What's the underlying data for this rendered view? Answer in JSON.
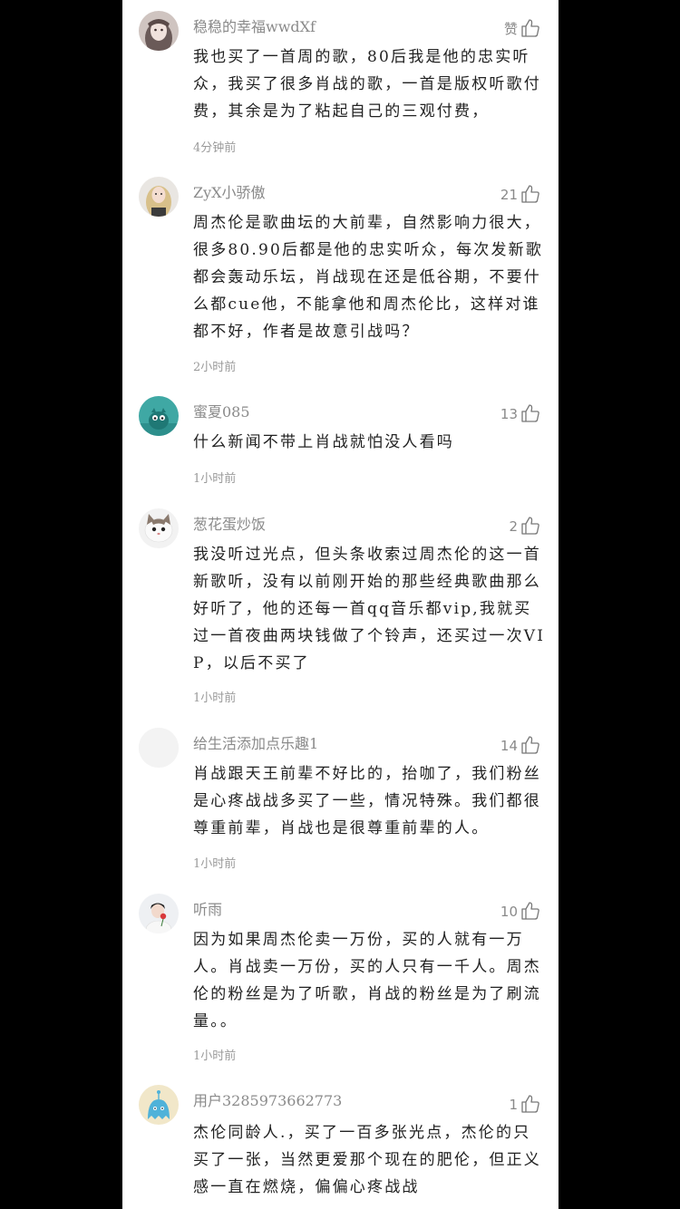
{
  "comments": [
    {
      "username": "稳稳的幸福wwdXf",
      "like_count": "赞",
      "content": "我也买了一首周的歌，80后我是他的忠实听众，我买了很多肖战的歌，一首是版权听歌付费，其余是为了粘起自己的三观付费，",
      "time": "4分钟前",
      "avatar_icon": "girl-portrait-avatar"
    },
    {
      "username": "ZyX小骄傲",
      "like_count": "21",
      "content": "周杰伦是歌曲坛的大前辈，自然影响力很大，很多80.90后都是他的忠实听众，每次发新歌都会轰动乐坛，肖战现在还是低谷期，不要什么都cue他，不能拿他和周杰伦比，这样对谁都不好，作者是故意引战吗？",
      "time": "2小时前",
      "avatar_icon": "blonde-woman-avatar"
    },
    {
      "username": "蜜夏085",
      "like_count": "13",
      "content": "什么新闻不带上肖战就怕没人看吗",
      "time": "1小时前",
      "avatar_icon": "teal-monster-avatar"
    },
    {
      "username": "葱花蛋炒饭",
      "like_count": "2",
      "content": "我没听过光点，但头条收索过周杰伦的这一首新歌听，没有以前刚开始的那些经典歌曲那么好听了，他的还每一首qq音乐都vip,我就买过一首夜曲两块钱做了个铃声，还买过一次VIP，以后不买了",
      "time": "1小时前",
      "avatar_icon": "cat-avatar"
    },
    {
      "username": "给生活添加点乐趣1",
      "like_count": "14",
      "content": "肖战跟天王前辈不好比的，抬咖了，我们粉丝是心疼战战多买了一些，情况特殊。我们都很尊重前辈，肖战也是很尊重前辈的人。",
      "time": "1小时前",
      "avatar_icon": "blank-avatar"
    },
    {
      "username": "听雨",
      "like_count": "10",
      "content": "因为如果周杰伦卖一万份，买的人就有一万人。肖战卖一万份，买的人只有一千人。周杰伦的粉丝是为了听歌，肖战的粉丝是为了刷流量。。",
      "time": "1小时前",
      "avatar_icon": "person-with-rose-avatar"
    },
    {
      "username": "用户3285973662773",
      "like_count": "1",
      "content": "杰伦同龄人.，买了一百多张光点，杰伦的只买了一张，当然更爱那个现在的肥伦，但正义感一直在燃烧，偏偏心疼战战",
      "time": "",
      "avatar_icon": "blue-ghost-avatar"
    }
  ],
  "icons": {
    "like": "thumbs-up-icon"
  }
}
